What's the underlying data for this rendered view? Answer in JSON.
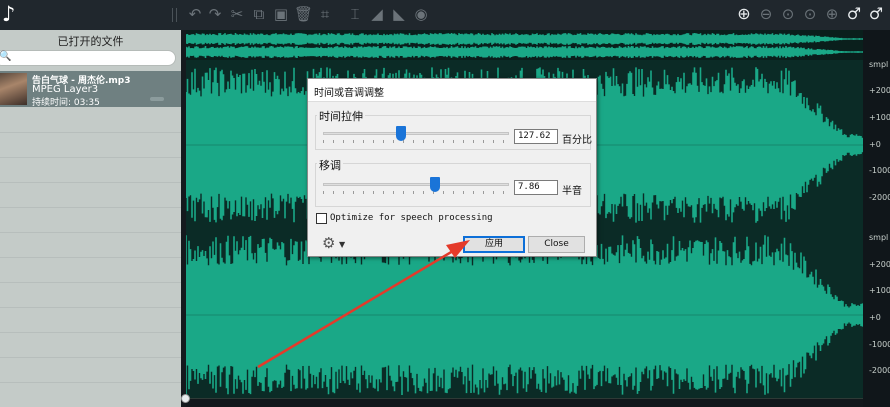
{
  "toolbar": {
    "icons": [
      "music-note-icon",
      "undo-icon",
      "redo-icon",
      "cut-icon",
      "copy-icon",
      "paste-icon",
      "delete-icon",
      "crop-icon",
      "text-cursor-icon",
      "fade-in-icon",
      "fade-out-icon",
      "record-icon",
      "zoom-in-icon",
      "zoom-out-icon",
      "zoom-selection-icon",
      "zoom-fit-icon",
      "zoom-full-icon",
      "zoom-vertical-in-icon",
      "zoom-vertical-out-icon"
    ]
  },
  "sidebar": {
    "title": "已打开的文件",
    "file": {
      "name": "告白气球 - 周杰伦.mp3",
      "format": "MPEG Layer3",
      "duration": "持续时间: 03:35"
    }
  },
  "scale": {
    "top": [
      "smpl",
      "+2000",
      "+1000",
      "+0",
      "-1000",
      "-2000"
    ],
    "bottom": [
      "smpl",
      "+2000",
      "+1000",
      "+0",
      "-1000",
      "-2000"
    ]
  },
  "dialog": {
    "title": "时间或音调调整",
    "stretch": {
      "label": "时间拉伸",
      "value": "127.62",
      "unit": "百分比",
      "slider_fraction": 0.42
    },
    "pitch": {
      "label": "移调",
      "value": "7.86",
      "unit": "半音",
      "slider_fraction": 0.6
    },
    "checkbox_label": "Optimize for speech processing",
    "checkbox_checked": false,
    "apply_label": "应用",
    "close_label": "Close"
  },
  "colors": {
    "waveform": "#1aa887",
    "waveform_bg": "#0b2b26",
    "annotation_arrow": "#e43a2a",
    "slider_thumb": "#1a74d8"
  }
}
